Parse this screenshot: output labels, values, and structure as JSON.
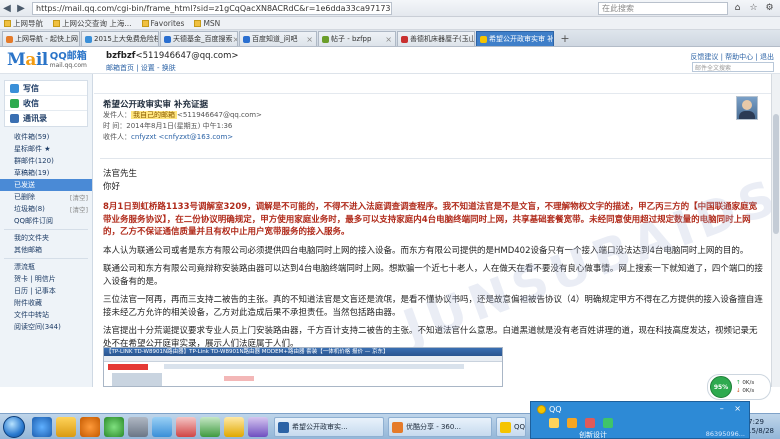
{
  "browser": {
    "url": "https://mail.qq.com/cgi-bin/frame_html?sid=z1gCqQacXN8ACRdC&r=1e6dda33ca9717339bf5f22fe48bf460",
    "search_placeholder": "在此搜索",
    "favorites": [
      "上网导航",
      "上网公交查询 上海...",
      "Favorites",
      "MSN"
    ],
    "tabs": [
      {
        "label": "上网导航 - 起快上网 从这里开...",
        "color": "#e57b2a",
        "active": false
      },
      {
        "label": "2015上大免费危险档案(十部)...",
        "color": "#3a8fd8",
        "active": false
      },
      {
        "label": "天德基金_百度搜索",
        "color": "#2a6fd0",
        "active": false
      },
      {
        "label": "百度知道_问吧",
        "color": "#2a6fd0",
        "active": false
      },
      {
        "label": "帖子 - bzfpp",
        "color": "#6b9e2a",
        "active": false
      },
      {
        "label": "善德机床器厘子(玉山)广场 - 恋...",
        "color": "#c93030",
        "active": false
      },
      {
        "label": "希望公开政审实审 补充证据",
        "color": "#f5c400",
        "active": true
      }
    ]
  },
  "header": {
    "logo_mail": "Mail",
    "logo_cn": "QQ邮箱",
    "logo_sub": "mail.qq.com",
    "user_name": "bzfbzf",
    "user_email": "<511946647@qq.com>",
    "user_links": "邮箱首页 | 设置 - 换肤",
    "right_links": "反馈建议 | 帮助中心 | 退出",
    "search_placeholder": "邮件全文搜索"
  },
  "sidebar": {
    "actions": [
      {
        "label": "写信",
        "color": "#3a8fd8"
      },
      {
        "label": "收信",
        "color": "#2eaa4f"
      },
      {
        "label": "通讯录",
        "color": "#3a6fb2"
      }
    ],
    "folders": [
      {
        "label": "收件箱(59)",
        "extra": "",
        "selected": false
      },
      {
        "label": "星标邮件 ★",
        "extra": "",
        "selected": false
      },
      {
        "label": "群邮件(120)",
        "extra": "",
        "selected": false
      },
      {
        "label": "草稿箱(19)",
        "extra": "",
        "selected": false
      },
      {
        "label": "已发送",
        "extra": "",
        "selected": true
      },
      {
        "label": "已删除",
        "extra": "[清空]",
        "selected": false
      },
      {
        "label": "垃圾箱(8)",
        "extra": "[清空]",
        "selected": false
      },
      {
        "label": "QQ邮件订阅",
        "extra": "",
        "selected": false
      }
    ],
    "folders2": [
      "我的文件夹",
      "其他邮箱"
    ],
    "folders3": [
      "漂流瓶",
      "贺卡 | 明信片",
      "日历 | 记事本",
      "附件收藏",
      "文件中转站",
      "阅读空间(344)"
    ]
  },
  "mail": {
    "subject": "希望公开政审实审 补充证据",
    "from_label": "发件人：",
    "from_value": "我自己的邮箱",
    "from_addr": "<511946647@qq.com>",
    "time_label": "时 间：",
    "time_value": "2014年8月1日(星期五) 中午1:36",
    "to_label": "收件人：",
    "to_value": "cnfyzxt <cnfyzxt@163.com>",
    "greeting": "法官先生",
    "hello": "你好",
    "paragraphs": [
      {
        "hl": true,
        "text": "8月1日到虹桥路1133号调解室3209，调解是不可能的，不得不进入法庭调查调查程序。我不知道法官是不是文盲，不理解物权文字的描述，甲乙丙三方的【中国联通家庭宽带业务服务协议】，在二份协议明确规定，甲方使用家庭业务时，最多可以支持家庭内4台电脑终端同时上网，共享基础套餐宽带。未经同意使用超过规定数量的电脑同时上网的，乙方不保证通信质量并且有权中止用户宽带服务的接入服务。"
      },
      {
        "hl": false,
        "text": "本人认为联通公司或者是东方有限公司必须提供四台电脑同时上网的接入设备。而东方有限公司提供的是HMD402设备只有一个接入端口没法达到4台电脑同时上网的目的。"
      },
      {
        "hl": false,
        "text": "联通公司和东方有限公司竟辩称安装路由器可以达到4台电脑终端同时上网。想欺骗一个近七十老人，人在做天在看不要没有良心做事情。网上搜索一下就知道了，四个端口的接入设备有的是。"
      },
      {
        "hl": false,
        "text": "三位法官一阿再，再而三支持二被告的主张。真的不知道法官是文盲还是流氓，是看不懂协议书吗，还是故意偏袒被告协议（4）明确规定甲方不得在乙方提供的接入设备擅自连接未经乙方允许的相关设备，乙方对此造成后果不承担责任。当然包括路由器。"
      },
      {
        "hl": false,
        "text": "法官提出十分荒诞提议要求专业人员上门安装路由器，千方百计支持二被告的主张。不知道法官什么意思。白道黑道就是没有老百姓讲理的道，现在科技高度发达，视频记录无处不在希望公开庭审实录，展示人们法庭属于人们。"
      }
    ],
    "watermark": "JUNSUBAIDS"
  },
  "embedded": {
    "title": "【TP-LINK TD-W8901N路由器】TP-Link TD-W8901N路由器 MODEM+路由器 套装【一体机价格 报价 — 京东】"
  },
  "network_widget": {
    "percent": "95%",
    "up": "0K/s",
    "down": "0K/s"
  },
  "qq_popup": {
    "title": "QQ",
    "user": "创新设计",
    "number": "86395096..."
  },
  "taskbar": {
    "tasks": [
      {
        "label": "希望公开政审实...",
        "color": "#2c63a6"
      },
      {
        "label": "优酷分享 - 360...",
        "color": "#e57b2a"
      },
      {
        "label": "QQ",
        "color": "#f5c400"
      }
    ],
    "time": "7:29",
    "date": "2015/8/28"
  },
  "colors": {
    "accent": "#3f7fc9",
    "qq_blue": "#2d8ad6",
    "highlight_red": "#b02a1a"
  }
}
